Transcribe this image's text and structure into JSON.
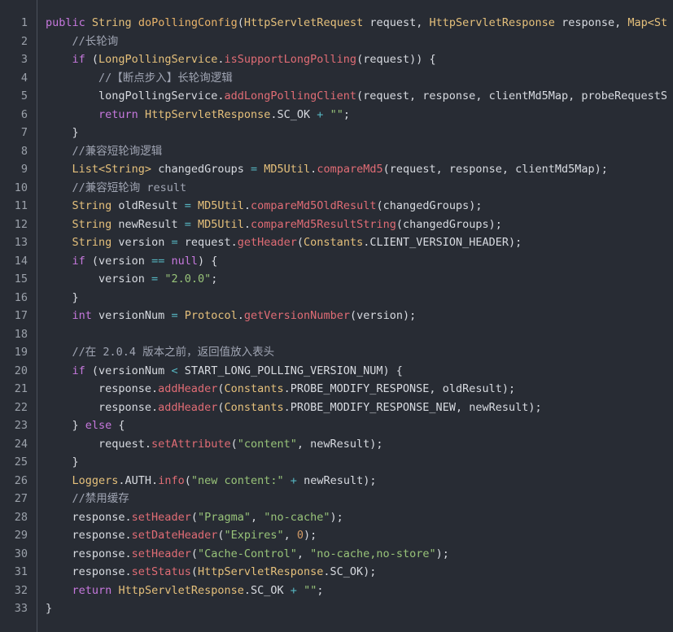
{
  "theme": {
    "colors": {
      "background": "#282c34",
      "text": "#d7dae0",
      "keyword": "#c678dd",
      "type": "#e5c07b",
      "decl": "#e8b36a",
      "method": "#e06c75",
      "string": "#98c379",
      "number": "#d19a66",
      "operator": "#56b6c2",
      "comment": "#a0a5b3",
      "line_number": "#9ba1aa",
      "gutter_border": "#4b515c"
    }
  },
  "code_block": {
    "lines": [
      {
        "number": "1",
        "tokens": [
          {
            "keyword": "public"
          },
          {
            "text": " "
          },
          {
            "type": "String"
          },
          {
            "text": " "
          },
          {
            "decl": "doPollingConfig"
          },
          {
            "text": "("
          },
          {
            "type": "HttpServletRequest"
          },
          {
            "text": " request, "
          },
          {
            "type": "HttpServletResponse"
          },
          {
            "text": " response, "
          },
          {
            "type": "Map<St"
          }
        ]
      },
      {
        "number": "2",
        "tokens": [
          {
            "text": "    "
          },
          {
            "comment": "//长轮询"
          }
        ]
      },
      {
        "number": "3",
        "tokens": [
          {
            "text": "    "
          },
          {
            "keyword": "if"
          },
          {
            "text": " ("
          },
          {
            "type": "LongPollingService"
          },
          {
            "text": "."
          },
          {
            "method": "isSupportLongPolling"
          },
          {
            "text": "(request)) {"
          }
        ]
      },
      {
        "number": "4",
        "tokens": [
          {
            "text": "        "
          },
          {
            "comment": "//【断点步入】长轮询逻辑"
          }
        ]
      },
      {
        "number": "5",
        "tokens": [
          {
            "text": "        longPollingService."
          },
          {
            "method": "addLongPollingClient"
          },
          {
            "text": "(request, response, clientMd5Map, probeRequestS"
          }
        ]
      },
      {
        "number": "6",
        "tokens": [
          {
            "text": "        "
          },
          {
            "keyword": "return"
          },
          {
            "text": " "
          },
          {
            "type": "HttpServletResponse"
          },
          {
            "text": ".SC_OK "
          },
          {
            "operator": "+"
          },
          {
            "text": " "
          },
          {
            "string": "\"\""
          },
          {
            "text": ";"
          }
        ]
      },
      {
        "number": "7",
        "tokens": [
          {
            "text": "    }"
          }
        ]
      },
      {
        "number": "8",
        "tokens": [
          {
            "text": "    "
          },
          {
            "comment": "//兼容短轮询逻辑"
          }
        ]
      },
      {
        "number": "9",
        "tokens": [
          {
            "text": "    "
          },
          {
            "type": "List<String>"
          },
          {
            "text": " changedGroups "
          },
          {
            "operator": "="
          },
          {
            "text": " "
          },
          {
            "type": "MD5Util"
          },
          {
            "text": "."
          },
          {
            "method": "compareMd5"
          },
          {
            "text": "(request, response, clientMd5Map);"
          }
        ]
      },
      {
        "number": "10",
        "tokens": [
          {
            "text": "    "
          },
          {
            "comment": "//兼容短轮询 result"
          }
        ]
      },
      {
        "number": "11",
        "tokens": [
          {
            "text": "    "
          },
          {
            "type": "String"
          },
          {
            "text": " oldResult "
          },
          {
            "operator": "="
          },
          {
            "text": " "
          },
          {
            "type": "MD5Util"
          },
          {
            "text": "."
          },
          {
            "method": "compareMd5OldResult"
          },
          {
            "text": "(changedGroups);"
          }
        ]
      },
      {
        "number": "12",
        "tokens": [
          {
            "text": "    "
          },
          {
            "type": "String"
          },
          {
            "text": " newResult "
          },
          {
            "operator": "="
          },
          {
            "text": " "
          },
          {
            "type": "MD5Util"
          },
          {
            "text": "."
          },
          {
            "method": "compareMd5ResultString"
          },
          {
            "text": "(changedGroups);"
          }
        ]
      },
      {
        "number": "13",
        "tokens": [
          {
            "text": "    "
          },
          {
            "type": "String"
          },
          {
            "text": " version "
          },
          {
            "operator": "="
          },
          {
            "text": " request."
          },
          {
            "method": "getHeader"
          },
          {
            "text": "("
          },
          {
            "type": "Constants"
          },
          {
            "text": ".CLIENT_VERSION_HEADER);"
          }
        ]
      },
      {
        "number": "14",
        "tokens": [
          {
            "text": "    "
          },
          {
            "keyword": "if"
          },
          {
            "text": " (version "
          },
          {
            "operator": "=="
          },
          {
            "text": " "
          },
          {
            "keyword": "null"
          },
          {
            "text": ") {"
          }
        ]
      },
      {
        "number": "15",
        "tokens": [
          {
            "text": "        version "
          },
          {
            "operator": "="
          },
          {
            "text": " "
          },
          {
            "string": "\"2.0.0\""
          },
          {
            "text": ";"
          }
        ]
      },
      {
        "number": "16",
        "tokens": [
          {
            "text": "    }"
          }
        ]
      },
      {
        "number": "17",
        "tokens": [
          {
            "text": "    "
          },
          {
            "keyword": "int"
          },
          {
            "text": " versionNum "
          },
          {
            "operator": "="
          },
          {
            "text": " "
          },
          {
            "type": "Protocol"
          },
          {
            "text": "."
          },
          {
            "method": "getVersionNumber"
          },
          {
            "text": "(version);"
          }
        ]
      },
      {
        "number": "18",
        "tokens": []
      },
      {
        "number": "19",
        "tokens": [
          {
            "text": "    "
          },
          {
            "comment": "//在 2.0.4 版本之前，返回值放入表头"
          }
        ]
      },
      {
        "number": "20",
        "tokens": [
          {
            "text": "    "
          },
          {
            "keyword": "if"
          },
          {
            "text": " (versionNum "
          },
          {
            "operator": "<"
          },
          {
            "text": " START_LONG_POLLING_VERSION_NUM) {"
          }
        ]
      },
      {
        "number": "21",
        "tokens": [
          {
            "text": "        response."
          },
          {
            "method": "addHeader"
          },
          {
            "text": "("
          },
          {
            "type": "Constants"
          },
          {
            "text": ".PROBE_MODIFY_RESPONSE, oldResult);"
          }
        ]
      },
      {
        "number": "22",
        "tokens": [
          {
            "text": "        response."
          },
          {
            "method": "addHeader"
          },
          {
            "text": "("
          },
          {
            "type": "Constants"
          },
          {
            "text": ".PROBE_MODIFY_RESPONSE_NEW, newResult);"
          }
        ]
      },
      {
        "number": "23",
        "tokens": [
          {
            "text": "    } "
          },
          {
            "keyword": "else"
          },
          {
            "text": " {"
          }
        ]
      },
      {
        "number": "24",
        "tokens": [
          {
            "text": "        request."
          },
          {
            "method": "setAttribute"
          },
          {
            "text": "("
          },
          {
            "string": "\"content\""
          },
          {
            "text": ", newResult);"
          }
        ]
      },
      {
        "number": "25",
        "tokens": [
          {
            "text": "    }"
          }
        ]
      },
      {
        "number": "26",
        "tokens": [
          {
            "text": "    "
          },
          {
            "type": "Loggers"
          },
          {
            "text": ".AUTH."
          },
          {
            "method": "info"
          },
          {
            "text": "("
          },
          {
            "string": "\"new content:\""
          },
          {
            "text": " "
          },
          {
            "operator": "+"
          },
          {
            "text": " newResult);"
          }
        ]
      },
      {
        "number": "27",
        "tokens": [
          {
            "text": "    "
          },
          {
            "comment": "//禁用缓存"
          }
        ]
      },
      {
        "number": "28",
        "tokens": [
          {
            "text": "    response."
          },
          {
            "method": "setHeader"
          },
          {
            "text": "("
          },
          {
            "string": "\"Pragma\""
          },
          {
            "text": ", "
          },
          {
            "string": "\"no-cache\""
          },
          {
            "text": ");"
          }
        ]
      },
      {
        "number": "29",
        "tokens": [
          {
            "text": "    response."
          },
          {
            "method": "setDateHeader"
          },
          {
            "text": "("
          },
          {
            "string": "\"Expires\""
          },
          {
            "text": ", "
          },
          {
            "number": "0"
          },
          {
            "text": ");"
          }
        ]
      },
      {
        "number": "30",
        "tokens": [
          {
            "text": "    response."
          },
          {
            "method": "setHeader"
          },
          {
            "text": "("
          },
          {
            "string": "\"Cache-Control\""
          },
          {
            "text": ", "
          },
          {
            "string": "\"no-cache,no-store\""
          },
          {
            "text": ");"
          }
        ]
      },
      {
        "number": "31",
        "tokens": [
          {
            "text": "    response."
          },
          {
            "method": "setStatus"
          },
          {
            "text": "("
          },
          {
            "type": "HttpServletResponse"
          },
          {
            "text": ".SC_OK);"
          }
        ]
      },
      {
        "number": "32",
        "tokens": [
          {
            "text": "    "
          },
          {
            "keyword": "return"
          },
          {
            "text": " "
          },
          {
            "type": "HttpServletResponse"
          },
          {
            "text": ".SC_OK "
          },
          {
            "operator": "+"
          },
          {
            "text": " "
          },
          {
            "string": "\"\""
          },
          {
            "text": ";"
          }
        ]
      },
      {
        "number": "33",
        "tokens": [
          {
            "text": "}"
          }
        ]
      }
    ]
  }
}
